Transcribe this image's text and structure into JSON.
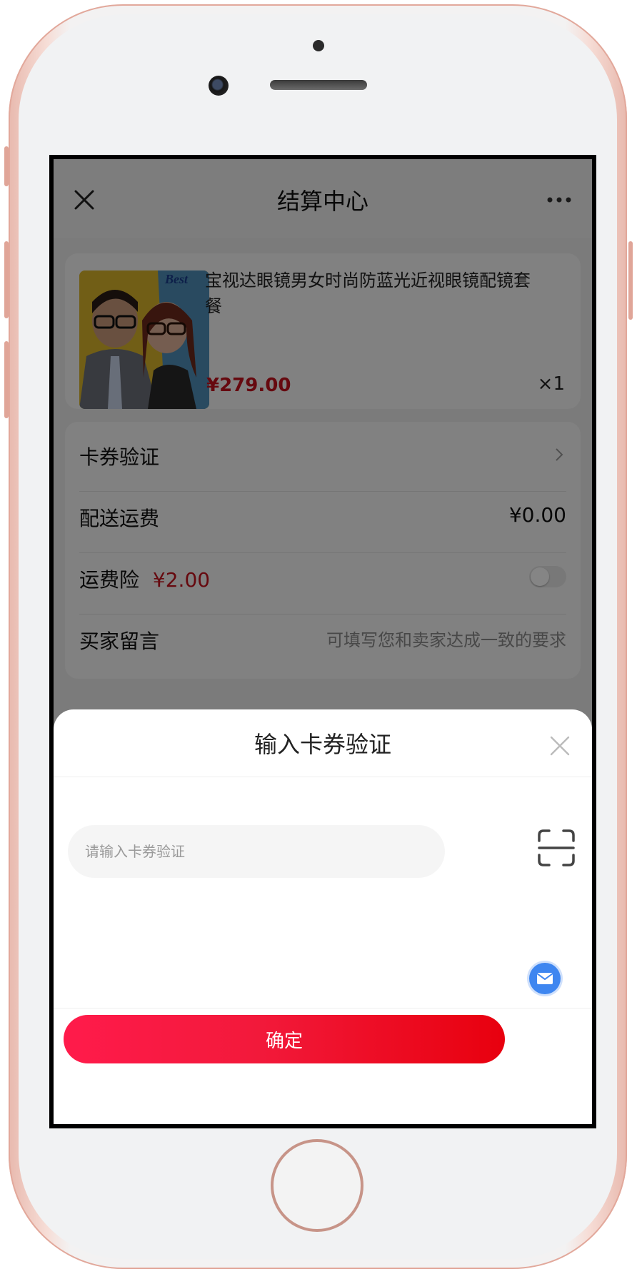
{
  "nav": {
    "title": "结算中心"
  },
  "product": {
    "title": "宝视达眼镜男女时尚防蓝光近视眼镜配镜套餐",
    "price": "¥279.00",
    "qty": "×1",
    "image_brand": "Best"
  },
  "rows": [
    {
      "label": "卡券验证",
      "value": ""
    },
    {
      "label": "配送运费",
      "value": "¥0.00"
    },
    {
      "label": "运费险",
      "price": "¥2.00",
      "toggle_on": false
    },
    {
      "label": "买家留言",
      "placeholder": "可填写您和卖家达成一致的要求"
    }
  ],
  "sheet": {
    "title": "输入卡券验证",
    "input_placeholder": "请输入卡券验证",
    "confirm_label": "确定"
  },
  "colors": {
    "accent": "#e8000e",
    "price": "#c4121e"
  },
  "icons": [
    "close-icon",
    "more-icon",
    "chevron-right-icon",
    "scan-icon",
    "mail-icon"
  ]
}
